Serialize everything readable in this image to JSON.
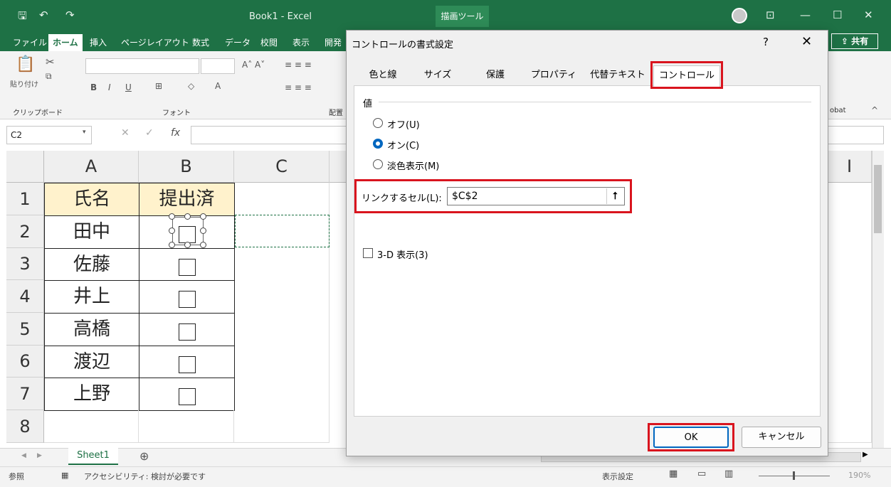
{
  "titlebar": {
    "title": "Book1  -  Excel",
    "drawing_tools": "描画ツール",
    "quick_access": [
      "save-icon",
      "undo-icon",
      "redo-icon"
    ],
    "window_controls": [
      "ribbon-display-icon",
      "minimize-icon",
      "maximize-icon",
      "close-icon"
    ]
  },
  "ribbon_tabs": [
    "ファイル",
    "ホーム",
    "挿入",
    "ページレイアウト",
    "数式",
    "データ",
    "校閲",
    "表示",
    "開発"
  ],
  "share_label": "共有",
  "ribbon": {
    "paste_label": "貼り付け",
    "clipboard_label": "クリップボード",
    "font_label": "フォント",
    "align_label": "配置",
    "acrobat_label": "obat"
  },
  "formula_bar": {
    "name_box": "C2",
    "fx": "fx"
  },
  "grid": {
    "columns": [
      "A",
      "B",
      "C",
      "I"
    ],
    "rows": [
      "1",
      "2",
      "3",
      "4",
      "5",
      "6",
      "7",
      "8"
    ],
    "header": {
      "a": "氏名",
      "b": "提出済"
    },
    "names": [
      "田中",
      "佐藤",
      "井上",
      "高橋",
      "渡辺",
      "上野"
    ]
  },
  "sheet": {
    "tab": "Sheet1",
    "add": "⊕"
  },
  "status": {
    "mode": "参照",
    "accessibility": "アクセシビリティ: 検討が必要です",
    "display_settings": "表示設定",
    "zoom": "190%"
  },
  "dialog": {
    "title": "コントロールの書式設定",
    "help": "?",
    "close": "✕",
    "tabs": [
      "色と線",
      "サイズ",
      "保護",
      "プロパティ",
      "代替テキスト",
      "コントロール"
    ],
    "active_tab": "コントロール",
    "value_group": "値",
    "options": [
      "オフ(U)",
      "オン(C)",
      "淡色表示(M)"
    ],
    "selected_option": "オン(C)",
    "link_label": "リンクするセル(L):",
    "link_value": "$C$2",
    "three_d": "3-D 表示(3)",
    "ok": "OK",
    "cancel": "キャンセル"
  }
}
